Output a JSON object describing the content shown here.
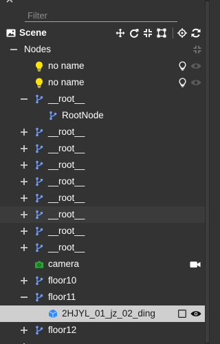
{
  "filter": {
    "placeholder": "Filter",
    "value": ""
  },
  "scene": {
    "label": "Scene"
  },
  "nodes_header": {
    "label": "Nodes"
  },
  "tree": [
    {
      "label": "no name",
      "icon": "bulb-icon",
      "expander": "none",
      "action": "light-visibility"
    },
    {
      "label": "no name",
      "icon": "bulb-icon",
      "expander": "none",
      "action": "light-visibility"
    },
    {
      "label": "__root__",
      "icon": "node-branch-icon",
      "expander": "collapse"
    },
    {
      "label": "RootNode",
      "icon": "node-branch-icon",
      "expander": "none"
    },
    {
      "label": "__root__",
      "icon": "node-branch-icon",
      "expander": "expand"
    },
    {
      "label": "__root__",
      "icon": "node-branch-icon",
      "expander": "expand"
    },
    {
      "label": "__root__",
      "icon": "node-branch-icon",
      "expander": "expand"
    },
    {
      "label": "__root__",
      "icon": "node-branch-icon",
      "expander": "expand"
    },
    {
      "label": "__root__",
      "icon": "node-branch-icon",
      "expander": "expand"
    },
    {
      "label": "__root__",
      "icon": "node-branch-icon",
      "expander": "expand"
    },
    {
      "label": "__root__",
      "icon": "node-branch-icon",
      "expander": "expand"
    },
    {
      "label": "__root__",
      "icon": "node-branch-icon",
      "expander": "expand"
    },
    {
      "label": "camera",
      "icon": "camera-icon",
      "expander": "none",
      "action": "video-camera"
    },
    {
      "label": "floor10",
      "icon": "node-branch-icon",
      "expander": "expand"
    },
    {
      "label": "floor11",
      "icon": "node-branch-icon",
      "expander": "collapse"
    },
    {
      "label": "2HJYL_01_jz_02_ding",
      "icon": "mesh-cube-icon",
      "expander": "none",
      "action": "checkbox-eye",
      "selected": true
    },
    {
      "label": "floor12",
      "icon": "node-branch-icon",
      "expander": "expand"
    }
  ],
  "colors": {
    "background": "#333333",
    "row_hover": "#3b3b3b",
    "selected_row": "#cfcfcf",
    "filter_underline": "#7aa4ff",
    "node_icon": "#6f9cff",
    "bulb_icon": "#ffe400",
    "camera_icon": "#24a82f",
    "mesh_icon": "#2f8cff"
  }
}
